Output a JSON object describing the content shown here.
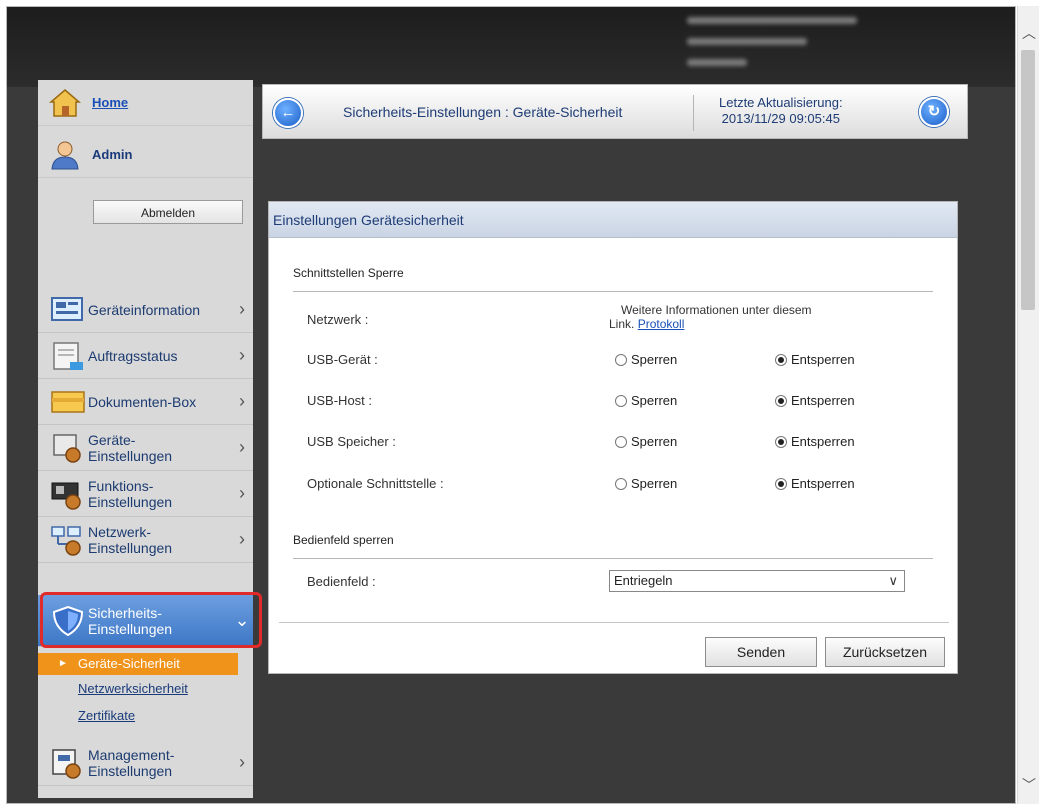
{
  "sidebar": {
    "home_label": "Home",
    "admin_label": "Admin",
    "logout_label": "Abmelden",
    "menu": [
      {
        "label": "Geräteinformation",
        "icon": "device-info-icon"
      },
      {
        "label": "Auftragsstatus",
        "icon": "job-status-icon"
      },
      {
        "label": "Dokumenten-Box",
        "icon": "document-box-icon"
      },
      {
        "label": "Geräte-\nEinstellungen",
        "icon": "device-settings-icon"
      },
      {
        "label": "Funktions-\nEinstellungen",
        "icon": "function-settings-icon"
      },
      {
        "label": "Netzwerk-\nEinstellungen",
        "icon": "network-settings-icon"
      },
      {
        "label": "Sicherheits-\nEinstellungen",
        "icon": "shield-icon"
      },
      {
        "label": "Management-\nEinstellungen",
        "icon": "management-settings-icon"
      }
    ],
    "submenu": [
      "Geräte-Sicherheit",
      "Netzwerksicherheit",
      "Zertifikate"
    ]
  },
  "header": {
    "title": "Sicherheits-Einstellungen : Geräte-Sicherheit",
    "updated_label": "Letzte Aktualisierung:",
    "updated_value": "2013/11/29 09:05:45"
  },
  "panel": {
    "title": "Einstellungen Gerätesicherheit",
    "section1": "Schnittstellen Sperre",
    "section2": "Bedienfeld sperren",
    "network_label": "Netzwerk :",
    "network_info": "Weitere Informationen unter diesem",
    "network_info2": "Link.",
    "network_link": "Protokoll",
    "rows": [
      {
        "label": "USB-Gerät :",
        "selected": "Entsperren"
      },
      {
        "label": "USB-Host :",
        "selected": "Entsperren"
      },
      {
        "label": "USB Speicher :",
        "selected": "Entsperren"
      },
      {
        "label": "Optionale Schnittstelle :",
        "selected": "Entsperren"
      }
    ],
    "option_lock": "Sperren",
    "option_unlock": "Entsperren",
    "panel_label": "Bedienfeld :",
    "panel_value": "Entriegeln",
    "send_label": "Senden",
    "reset_label": "Zurücksetzen"
  },
  "colors": {
    "highlight": "#e12a2a",
    "active_menu": "#3d77c6",
    "current_submenu": "#f0931b"
  }
}
